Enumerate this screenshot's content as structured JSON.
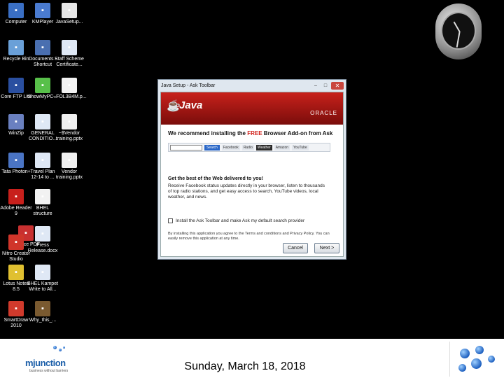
{
  "desktop_icons": [
    {
      "label": "Computer",
      "icon": "computer-icon",
      "color": "#3a6fc4"
    },
    {
      "label": "KMPlayer",
      "icon": "kmplayer-icon",
      "color": "#4a7bd0"
    },
    {
      "label": "JavaSetup...",
      "icon": "java-setup-icon",
      "color": "#e6e6e6"
    },
    {
      "label": "Recycle Bin",
      "icon": "recycle-bin-icon",
      "color": "#6aa0d8"
    },
    {
      "label": "Documents - Shortcut",
      "icon": "documents-shortcut-icon",
      "color": "#4a6fb0"
    },
    {
      "label": "Staff Scheme Certificate...",
      "icon": "document-icon",
      "color": "#dfe8f5"
    },
    {
      "label": "Core FTP Lite",
      "icon": "ftp-icon",
      "color": "#2a4fa0"
    },
    {
      "label": "ShowMyPC...",
      "icon": "showmypc-icon",
      "color": "#58c04a"
    },
    {
      "label": "~FOL3B4M.p...",
      "icon": "pdf-icon",
      "color": "#f2f2f2"
    },
    {
      "label": "WinZip",
      "icon": "winzip-icon",
      "color": "#6a80c0"
    },
    {
      "label": "GENERAL CONDITIO...",
      "icon": "document-icon",
      "color": "#dfe8f5"
    },
    {
      "label": "~$Vendor training.pptx",
      "icon": "pptx-icon",
      "color": "#f0f0f0"
    },
    {
      "label": "Tata Photon+",
      "icon": "tata-photon-icon",
      "color": "#4a74c4"
    },
    {
      "label": "Travel Plan 12-14 to ...",
      "icon": "document-icon",
      "color": "#dfe8f5"
    },
    {
      "label": "Vendor training.pptx",
      "icon": "pptx-icon",
      "color": "#f0f0f0"
    },
    {
      "label": "Adobe Reader 9",
      "icon": "adobe-reader-icon",
      "color": "#c8201c"
    },
    {
      "label": "BHEL structure",
      "icon": "pdf-icon",
      "color": "#f2f2f2"
    },
    {
      "label": "Nuance PDF",
      "icon": "nuance-pdf-icon",
      "color": "#c83030"
    },
    {
      "label": "Nitro Creator Studio",
      "icon": "nitro-creator-icon",
      "color": "#d0352a"
    },
    {
      "label": "Press Release.docx",
      "icon": "document-icon",
      "color": "#dfe8f5"
    },
    {
      "label": "Lotus Notes 8.5",
      "icon": "lotus-notes-icon",
      "color": "#e0c030"
    },
    {
      "label": "BHEL Kampet Write to All...",
      "icon": "document-icon",
      "color": "#dfe8f5"
    },
    {
      "label": "SmartDraw 2010",
      "icon": "smartdraw-icon",
      "color": "#d03a2c"
    },
    {
      "label": "Why_this_...",
      "icon": "why-this-icon",
      "color": "#7a5a30"
    }
  ],
  "dialog": {
    "title": "Java Setup - Ask Toolbar",
    "minimize": "–",
    "maximize": "□",
    "close": "✕",
    "java_logo": "Java",
    "oracle": "ORACLE",
    "recommend_prefix": "We recommend installing the ",
    "recommend_free": "FREE",
    "recommend_suffix": " Browser Add-on from Ask",
    "toolbar_preview": {
      "search_button": "Search",
      "items": [
        "Facebook",
        "Radio",
        "Weather",
        "Amazon",
        "YouTube"
      ]
    },
    "heading": "Get the best of the Web delivered to you!",
    "description": "Receive Facebook status updates directly in your browser, listen to thousands of top radio stations, and get easy access to search, YouTube videos, local weather, and news.",
    "checkbox_label": "Install the Ask Toolbar and make Ask my default search provider",
    "fine_print": "By installing this application you agree to the Terms and conditions and Privacy Policy. You can easily remove this application at any time.",
    "cancel": "Cancel",
    "next": "Next >"
  },
  "footer": {
    "logo_text": "mjunction",
    "logo_tagline": "business without barriers",
    "date": "Sunday, March 18, 2018"
  },
  "colors": {
    "java_red": "#c8211b",
    "free_red": "#d0201a",
    "mjunction_blue": "#1b5ea8"
  }
}
